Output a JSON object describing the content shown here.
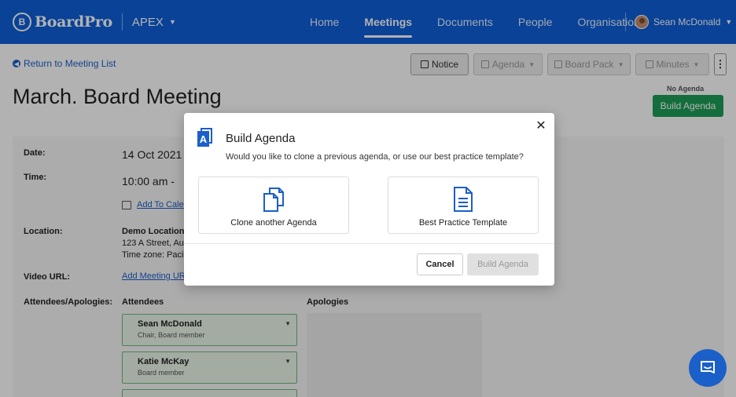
{
  "brand": {
    "name": "BoardPro",
    "mark": "B"
  },
  "topnav": {
    "org": "APEX",
    "links": [
      {
        "label": "Home"
      },
      {
        "label": "Meetings"
      },
      {
        "label": "Documents"
      },
      {
        "label": "People"
      },
      {
        "label": "Organisation"
      }
    ],
    "user": "Sean McDonald"
  },
  "page": {
    "back_link": "Return to Meeting List",
    "title": "March. Board Meeting",
    "toolbar": {
      "notice": "Notice",
      "agenda": "Agenda",
      "board_pack": "Board Pack",
      "minutes": "Minutes",
      "more": "⋮"
    },
    "no_agenda": "No Agenda",
    "build_agenda": "Build Agenda"
  },
  "details": {
    "date_label": "Date:",
    "date_value": "14 Oct 2021",
    "time_label": "Time:",
    "time_value": "10:00 am  -",
    "add_calendar": "Add To Cale",
    "location_label": "Location:",
    "location_name": "Demo Location",
    "location_street": "123 A Street, Au",
    "timezone": "Time zone: Paci",
    "video_label": "Video URL:",
    "video_link": "Add Meeting UR",
    "attendees_label": "Attendees/Apologies:",
    "attendees_heading": "Attendees",
    "apologies_heading": "Apologies",
    "attendees": [
      {
        "name": "Sean McDonald",
        "role": "Chair, Board member"
      },
      {
        "name": "Katie McKay",
        "role": "Board member"
      }
    ]
  },
  "modal": {
    "title": "Build Agenda",
    "description": "Would you like to clone a previous agenda, or use our best practice template?",
    "option_clone": "Clone another Agenda",
    "option_template": "Best Practice Template",
    "cancel": "Cancel",
    "build": "Build Agenda",
    "icon_letter": "A"
  },
  "colors": {
    "nav_blue": "#0d5fd8",
    "accent_blue": "#1b5fc9",
    "green": "#1e9c57"
  }
}
